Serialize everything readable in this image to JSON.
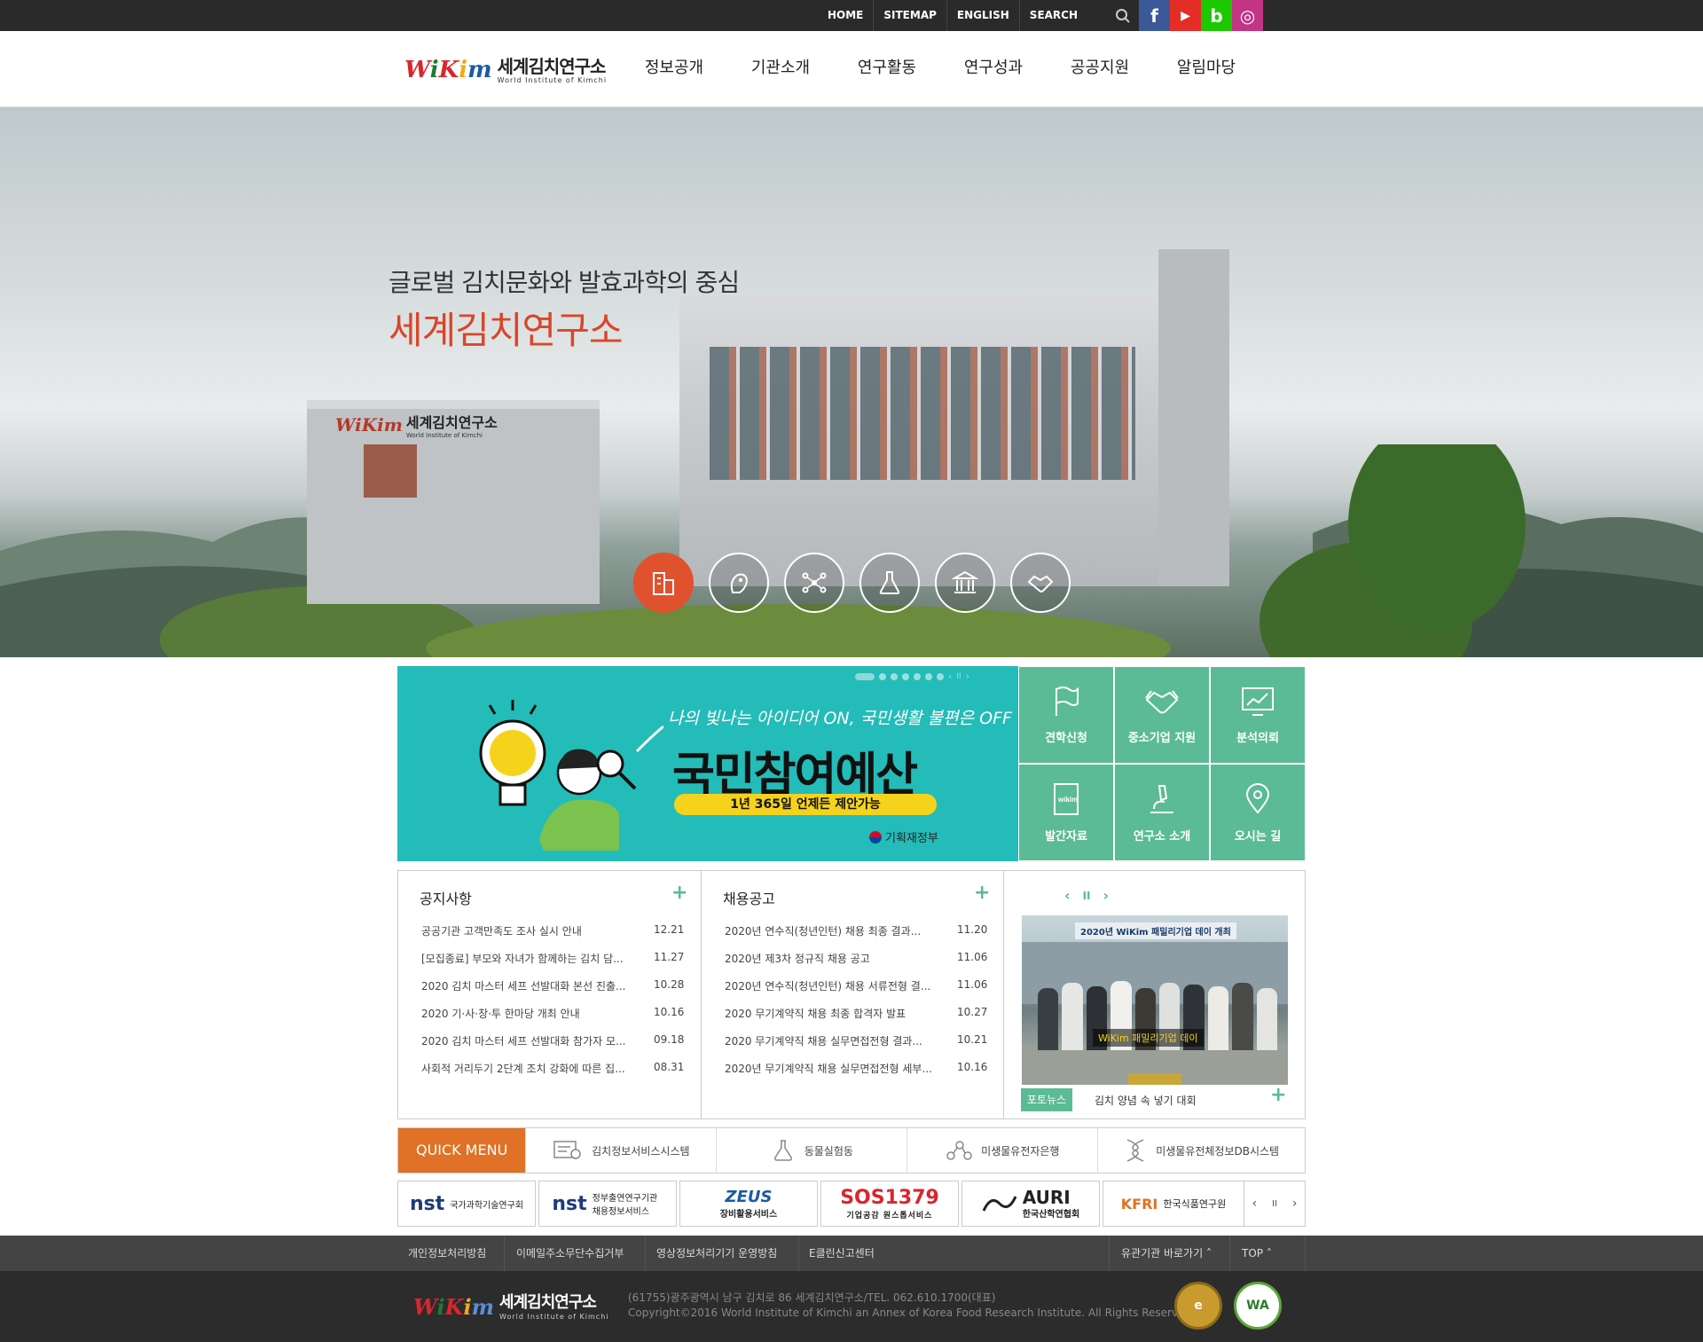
{
  "topbar": {
    "nav": [
      "HOME",
      "SITEMAP",
      "ENGLISH",
      "SEARCH"
    ],
    "sns": [
      {
        "label": "f",
        "icon": "facebook-icon",
        "color": "#3b5998"
      },
      {
        "label": "▶",
        "icon": "youtube-icon",
        "color": "#e52d27"
      },
      {
        "label": "b",
        "icon": "blog-icon",
        "color": "#1ec800"
      },
      {
        "label": "◎",
        "icon": "instagram-icon",
        "color": "#c13584"
      }
    ]
  },
  "header": {
    "logo_en": "WiKim",
    "logo_ko": "세계김치연구소",
    "logo_sub": "World Institute of Kimchi",
    "gnb": [
      "정보공개",
      "기관소개",
      "연구활동",
      "연구성과",
      "공공지원",
      "알림마당"
    ]
  },
  "hero": {
    "subtitle": "글로벌 김치문화와 발효과학의 중심",
    "title": "세계김치연구소",
    "building_sign_en": "WiKim",
    "building_sign_ko": "세계김치연구소",
    "building_sign_sub": "World Institute of Kimchi",
    "icons": [
      "building-icon",
      "lion-icon",
      "network-icon",
      "flask-icon",
      "institution-icon",
      "handshake-icon"
    ]
  },
  "banner": {
    "handwriting": "나의 빛나는 아이디어 ON, 국민생활 불편은 OFF",
    "title": "국민참여예산",
    "pill": "1년 365일 언제든 제안가능",
    "org": "기획재정부"
  },
  "quick_grid": [
    {
      "label": "견학신청",
      "icon": "flag-icon"
    },
    {
      "label": "중소기업 지원",
      "icon": "handshake-icon"
    },
    {
      "label": "분석의뢰",
      "icon": "monitor-chart-icon"
    },
    {
      "label": "발간자료",
      "icon": "book-icon"
    },
    {
      "label": "연구소 소개",
      "icon": "microscope-icon"
    },
    {
      "label": "오시는 길",
      "icon": "map-pin-icon"
    }
  ],
  "notice": {
    "title": "공지사항",
    "items": [
      {
        "text": "공공기관 고객만족도 조사 실시 안내",
        "date": "12.21"
      },
      {
        "text": "[모집종료] 부모와 자녀가 함께하는 김치 담...",
        "date": "11.27"
      },
      {
        "text": "2020 김치 마스터 세프 선발대화 본선 진출...",
        "date": "10.28"
      },
      {
        "text": "2020 기·사·창·투 한마당 개최 안내",
        "date": "10.16"
      },
      {
        "text": "2020 김치 마스터 세프 선발대화 참가자 모...",
        "date": "09.18"
      },
      {
        "text": "사회적 거리두기 2단계 조치 강화에 따른 집...",
        "date": "08.31"
      }
    ]
  },
  "recruit": {
    "title": "채용공고",
    "items": [
      {
        "text": "2020년 연수직(청년인턴) 채용 최종 결과...",
        "date": "11.20"
      },
      {
        "text": "2020년 제3차 정규직 채용 공고",
        "date": "11.06"
      },
      {
        "text": "2020년 연수직(청년인턴) 채용 서류전형 결...",
        "date": "11.06"
      },
      {
        "text": "2020 무기계약직 채용 최종 합격자 발표",
        "date": "10.27"
      },
      {
        "text": "2020 무기계약직 채용 실무면접전형 결과...",
        "date": "10.21"
      },
      {
        "text": "2020년 무기계약직 채용 실무면접전형 세부...",
        "date": "10.16"
      }
    ]
  },
  "photo_news": {
    "photo_banner": "2020년 WiKim 패밀리기업 데이 개최",
    "photo_overlay": "WiKim 패밀리기업 데이",
    "tag": "포토뉴스",
    "caption": "김치 양념 속 넣기 대회"
  },
  "quick_menu": {
    "label": "QUICK MENU",
    "items": [
      {
        "label": "김치정보서비스시스템",
        "icon": "info-system-icon"
      },
      {
        "label": "동물실험동",
        "icon": "flask-icon"
      },
      {
        "label": "미생물유전자은행",
        "icon": "molecule-icon"
      },
      {
        "label": "미생물유전체정보DB시스템",
        "icon": "dna-icon"
      }
    ]
  },
  "partners": [
    {
      "mark": "nst",
      "label": "국가과학기술연구회"
    },
    {
      "mark": "nst",
      "label": "정부출연연구기관 채용정보서비스"
    },
    {
      "mark": "ZEUS",
      "label": "장비활용서비스"
    },
    {
      "mark": "SOS1379",
      "label": "기업공감 원스톱서비스"
    },
    {
      "mark": "AURI",
      "label": "한국산학연협회"
    },
    {
      "mark": "KFRI",
      "label": "한국식품연구원"
    }
  ],
  "footer": {
    "links": [
      "개인정보처리방침",
      "이메일주소무단수집거부",
      "영상정보처리기기 운영방침",
      "E클린신고센터"
    ],
    "related": "유관기관 바로가기",
    "top": "TOP",
    "address": "(61755)광주광역시 남구 김치로 86 세계김치연구소/TEL. 062.610.1700(대표)",
    "copyright": "Copyright©2016 World Institute of Kimchi an Annex of Korea Food Research Institute. All Rights Reserved.",
    "badge1": "e",
    "badge2": "WA"
  },
  "colors": {
    "accent_green": "#5bbb96",
    "accent_orange": "#e07126",
    "hero_red": "#d9462a",
    "banner_teal": "#23bcb8"
  }
}
